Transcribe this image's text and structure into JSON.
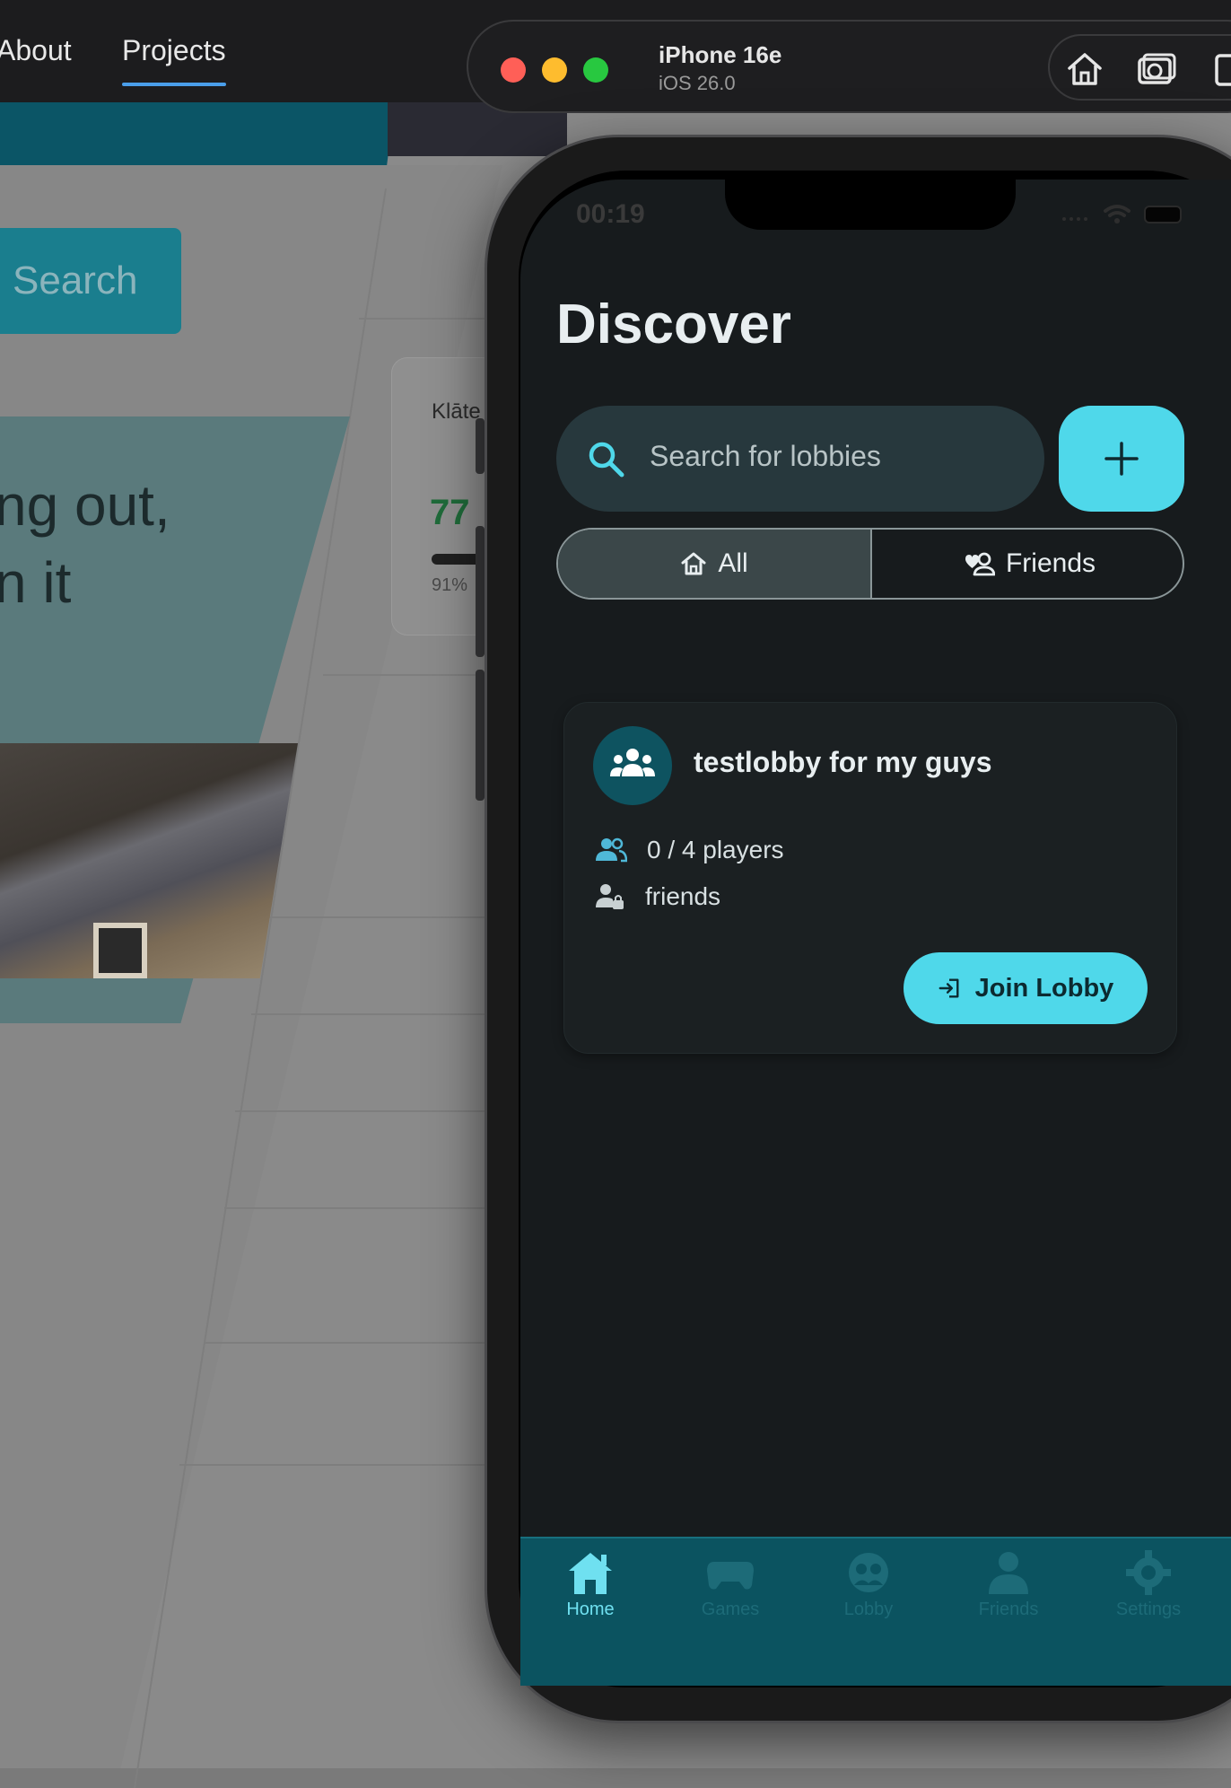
{
  "background_site": {
    "nav": {
      "about_label": "About",
      "projects_label": "Projects"
    },
    "search_button_label": "Search",
    "hero_text_line1": "ng out,",
    "hero_text_line2": "n it",
    "stat_card": {
      "label": "Klāte",
      "value": "77",
      "percent": "91%"
    }
  },
  "simulator": {
    "device_name": "iPhone 16e",
    "os_version": "iOS 26.0",
    "tools": [
      "home-icon",
      "screenshot-icon",
      "rotate-icon"
    ]
  },
  "status_bar": {
    "time": "00:19"
  },
  "discover": {
    "title": "Discover",
    "search_placeholder": "Search for lobbies",
    "add_button_icon": "plus-icon",
    "filters": {
      "all_label": "All",
      "friends_label": "Friends",
      "selected": "All"
    }
  },
  "lobbies": [
    {
      "name": "testlobby for my guys",
      "players": "0 / 4 players",
      "privacy": "friends",
      "join_label": "Join Lobby"
    }
  ],
  "tabbar": {
    "tabs": [
      {
        "label": "Home",
        "icon": "home-icon",
        "active": true
      },
      {
        "label": "Games",
        "icon": "gamepad-icon",
        "active": false
      },
      {
        "label": "Lobby",
        "icon": "lobby-icon",
        "active": false
      },
      {
        "label": "Friends",
        "icon": "person-icon",
        "active": false
      },
      {
        "label": "Settings",
        "icon": "gear-icon",
        "active": false
      }
    ]
  },
  "colors": {
    "accent": "#4fd8ea",
    "screen_bg": "#171b1d",
    "tabbar_bg": "#0b5360"
  }
}
